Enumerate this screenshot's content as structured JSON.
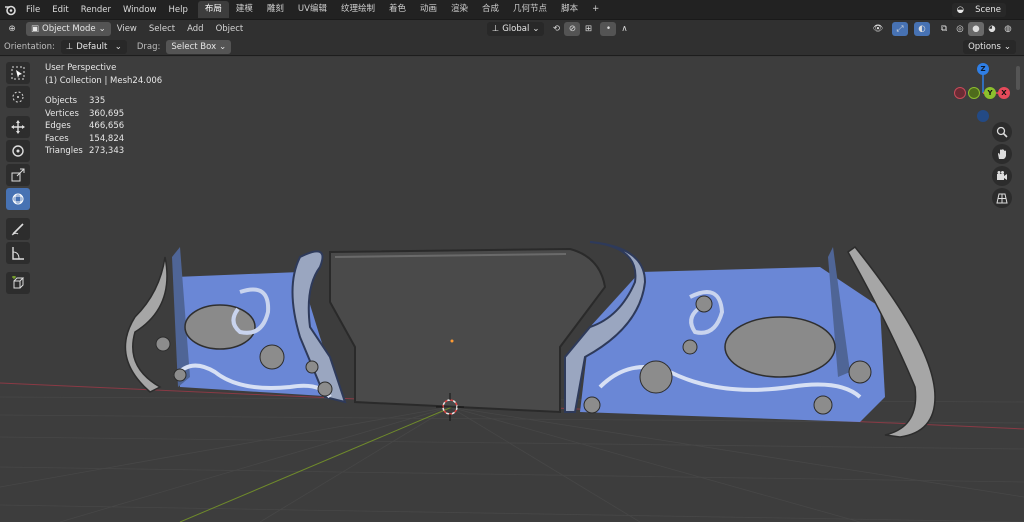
{
  "topbar": {
    "menus": [
      "File",
      "Edit",
      "Render",
      "Window",
      "Help"
    ],
    "workspaces": [
      "布局",
      "建模",
      "雕刻",
      "UV编辑",
      "纹理绘制",
      "着色",
      "动画",
      "渲染",
      "合成",
      "几何节点",
      "脚本"
    ],
    "add_tab": "+",
    "scene": "Scene"
  },
  "header": {
    "mode": "Object Mode",
    "menus": [
      "View",
      "Select",
      "Add",
      "Object"
    ],
    "transform_orientation": "Global"
  },
  "tool_settings": {
    "orientation_label": "Orientation:",
    "orientation_value": "Default",
    "drag_label": "Drag:",
    "drag_value": "Select Box",
    "options": "Options"
  },
  "overlay": {
    "view_name": "User Perspective",
    "collection": "(1) Collection | Mesh24.006",
    "stats": [
      {
        "label": "Objects",
        "value": "335"
      },
      {
        "label": "Vertices",
        "value": "360,695"
      },
      {
        "label": "Edges",
        "value": "466,656"
      },
      {
        "label": "Faces",
        "value": "154,824"
      },
      {
        "label": "Triangles",
        "value": "273,343"
      }
    ]
  },
  "gizmo": {
    "z": "Z",
    "y": "Y",
    "x": "X"
  },
  "colors": {
    "active_tool": "#4772b3",
    "mesh_blue": "#6a87d6",
    "mesh_gray": "#8e8e8e",
    "axis_x": "#e64a5a",
    "axis_y": "#8cbf2d",
    "axis_z": "#2f7fe6"
  }
}
